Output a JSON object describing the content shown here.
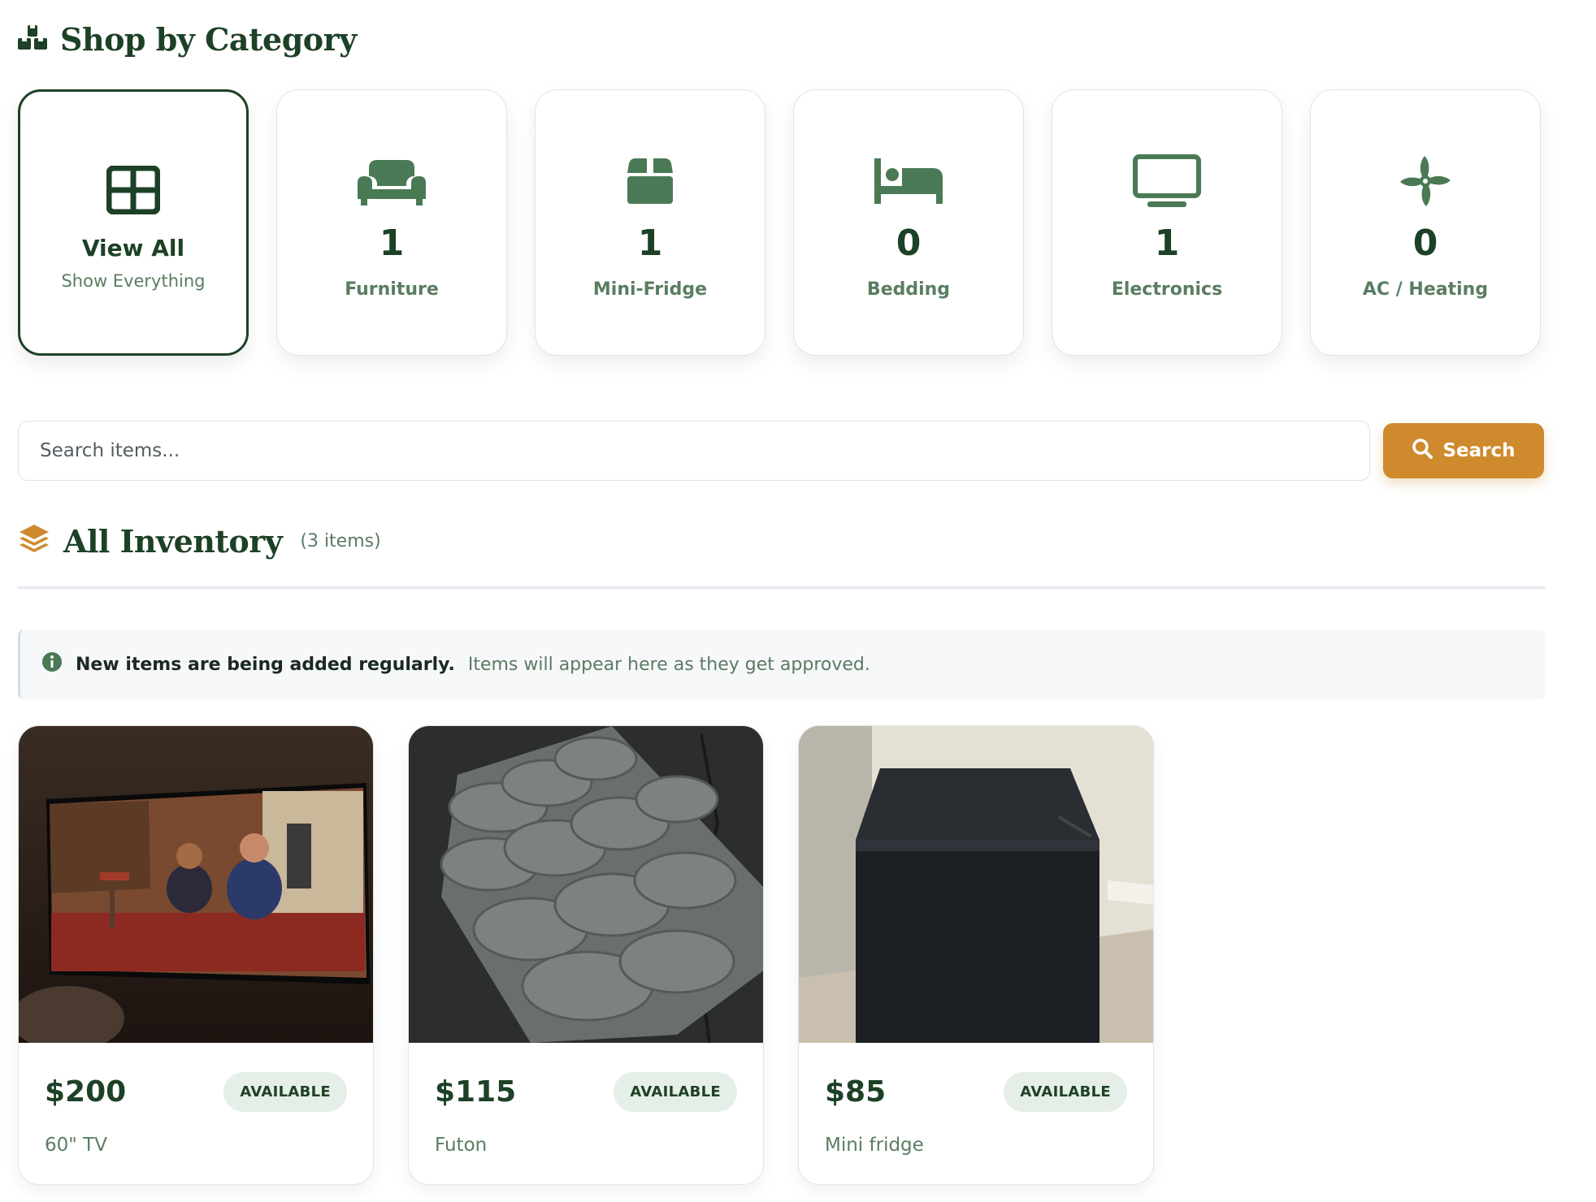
{
  "categories_section": {
    "title": "Shop by Category",
    "icon": "boxes-icon"
  },
  "categories": [
    {
      "id": "all",
      "title": "View All",
      "subtitle": "Show Everything",
      "icon": "grid-icon",
      "active": true
    },
    {
      "id": "furniture",
      "count": "1",
      "label": "Furniture",
      "icon": "couch-icon"
    },
    {
      "id": "mini-fridge",
      "count": "1",
      "label": "Mini-Fridge",
      "icon": "box-icon"
    },
    {
      "id": "bedding",
      "count": "0",
      "label": "Bedding",
      "icon": "bed-icon"
    },
    {
      "id": "electronics",
      "count": "1",
      "label": "Electronics",
      "icon": "tv-icon"
    },
    {
      "id": "ac-heating",
      "count": "0",
      "label": "AC / Heating",
      "icon": "fan-icon"
    }
  ],
  "search": {
    "placeholder": "Search items...",
    "button_label": "Search",
    "button_icon": "search-icon"
  },
  "inventory": {
    "title": "All Inventory",
    "count_label": "(3 items)",
    "icon": "layers-icon"
  },
  "notice": {
    "icon": "info-icon",
    "strong": "New items are being added regularly.",
    "text": "Items will appear here as they get approved."
  },
  "products": [
    {
      "price": "$200",
      "status": "AVAILABLE",
      "name": "60\" TV"
    },
    {
      "price": "$115",
      "status": "AVAILABLE",
      "name": "Futon"
    },
    {
      "price": "$85",
      "status": "AVAILABLE",
      "name": "Mini fridge"
    }
  ],
  "colors": {
    "primary": "#1d4126",
    "muted": "#5a7d61",
    "accent": "#cf8a2e",
    "icon_green": "#4a7a55"
  }
}
